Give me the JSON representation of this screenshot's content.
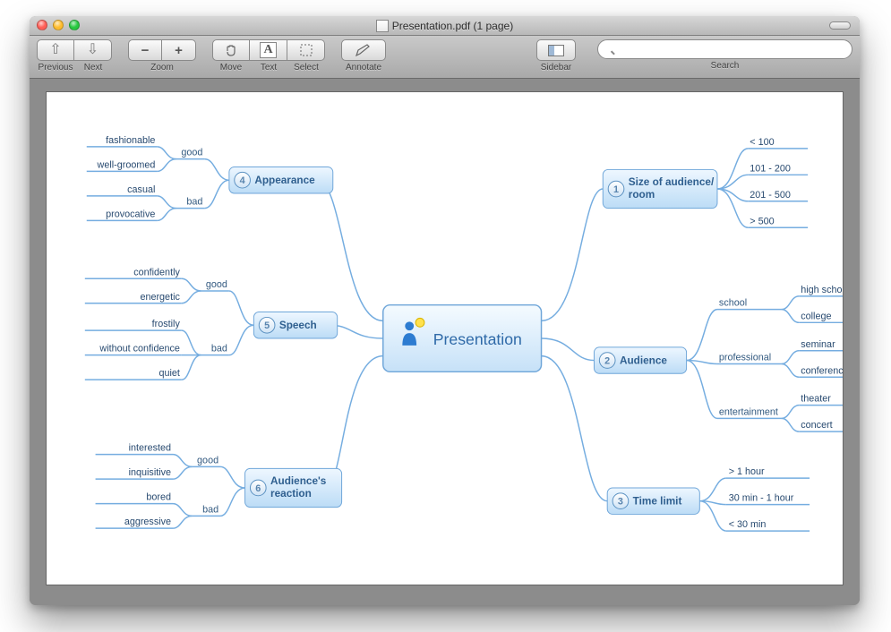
{
  "window": {
    "title": "Presentation.pdf (1 page)"
  },
  "toolbar": {
    "previous": "Previous",
    "next": "Next",
    "zoom": "Zoom",
    "move": "Move",
    "text": "Text",
    "select": "Select",
    "annotate": "Annotate",
    "sidebar": "Sidebar",
    "search": "Search",
    "search_placeholder": ""
  },
  "mindmap": {
    "center": "Presentation",
    "right": [
      {
        "num": "1",
        "label": "Size of audience/\nroom",
        "children": [
          {
            "label": "< 100"
          },
          {
            "label": "101 - 200"
          },
          {
            "label": "201 - 500"
          },
          {
            "label": "> 500"
          }
        ]
      },
      {
        "num": "2",
        "label": "Audience",
        "children": [
          {
            "label": "school",
            "children": [
              {
                "label": "high school"
              },
              {
                "label": "college"
              }
            ]
          },
          {
            "label": "professional",
            "children": [
              {
                "label": "seminar"
              },
              {
                "label": "conference"
              }
            ]
          },
          {
            "label": "entertainment",
            "children": [
              {
                "label": "theater"
              },
              {
                "label": "concert"
              }
            ]
          }
        ]
      },
      {
        "num": "3",
        "label": "Time limit",
        "children": [
          {
            "label": "> 1 hour"
          },
          {
            "label": "30 min - 1 hour"
          },
          {
            "label": "< 30 min"
          }
        ]
      }
    ],
    "left": [
      {
        "num": "4",
        "label": "Appearance",
        "children": [
          {
            "label": "good",
            "children": [
              {
                "label": "fashionable"
              },
              {
                "label": "well-groomed"
              }
            ]
          },
          {
            "label": "bad",
            "children": [
              {
                "label": "casual"
              },
              {
                "label": "provocative"
              }
            ]
          }
        ]
      },
      {
        "num": "5",
        "label": "Speech",
        "children": [
          {
            "label": "good",
            "children": [
              {
                "label": "confidently"
              },
              {
                "label": "energetic"
              }
            ]
          },
          {
            "label": "bad",
            "children": [
              {
                "label": "frostily"
              },
              {
                "label": "without confidence"
              },
              {
                "label": "quiet"
              }
            ]
          }
        ]
      },
      {
        "num": "6",
        "label": "Audience's\nreaction",
        "children": [
          {
            "label": "good",
            "children": [
              {
                "label": "interested"
              },
              {
                "label": "inquisitive"
              }
            ]
          },
          {
            "label": "bad",
            "children": [
              {
                "label": "bored"
              },
              {
                "label": "aggressive"
              }
            ]
          }
        ]
      }
    ]
  }
}
